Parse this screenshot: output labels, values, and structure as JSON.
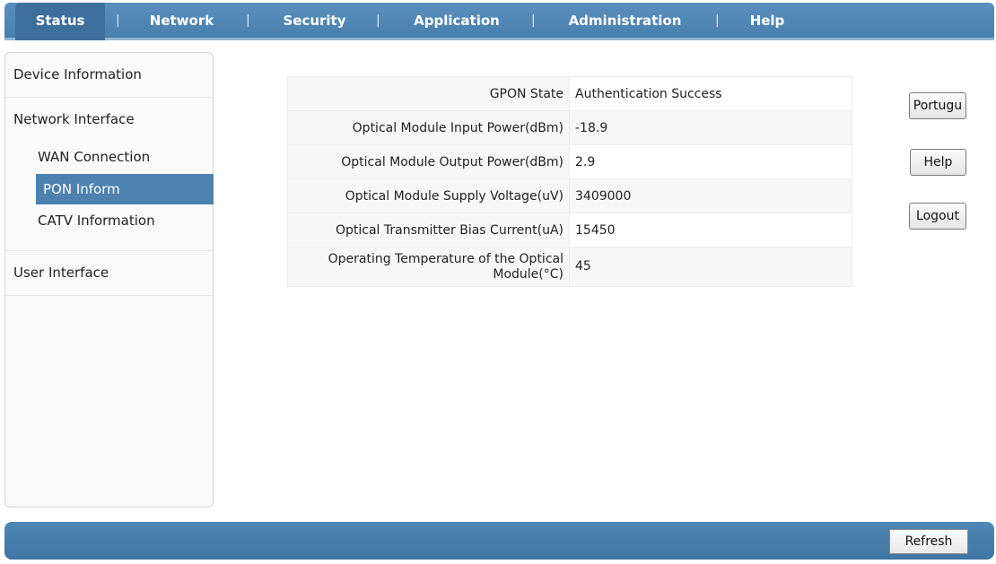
{
  "nav": {
    "items": [
      {
        "label": "Status",
        "active": true
      },
      {
        "label": "Network"
      },
      {
        "label": "Security"
      },
      {
        "label": "Application"
      },
      {
        "label": "Administration"
      },
      {
        "label": "Help"
      }
    ],
    "separator": "|"
  },
  "sidebar": {
    "device_information": "Device Information",
    "network_interface": "Network Interface",
    "wan_connection": "WAN Connection",
    "pon_inform": "PON Inform",
    "catv_information": "CATV Information",
    "user_interface": "User Interface"
  },
  "pon_info": {
    "rows": [
      {
        "label": "GPON State",
        "value": "Authentication Success"
      },
      {
        "label": "Optical Module Input Power(dBm)",
        "value": "-18.9"
      },
      {
        "label": "Optical Module Output Power(dBm)",
        "value": "2.9"
      },
      {
        "label": "Optical Module Supply Voltage(uV)",
        "value": "3409000"
      },
      {
        "label": "Optical Transmitter Bias Current(uA)",
        "value": "15450"
      },
      {
        "label": "Operating Temperature of the Optical Module(°C)",
        "value": "45"
      }
    ]
  },
  "buttons": {
    "language": "Portugu",
    "help": "Help",
    "logout": "Logout",
    "refresh": "Refresh"
  }
}
